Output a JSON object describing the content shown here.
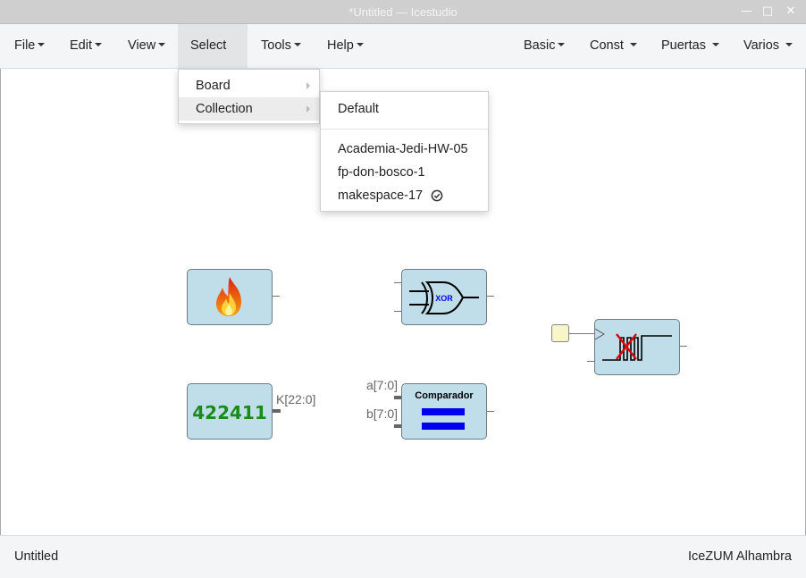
{
  "window": {
    "title": "*Untitled — Icestudio"
  },
  "menubar": {
    "left": [
      {
        "label": "File"
      },
      {
        "label": "Edit"
      },
      {
        "label": "View"
      },
      {
        "label": "Select"
      },
      {
        "label": "Tools"
      },
      {
        "label": "Help"
      }
    ],
    "right": [
      {
        "label": "Basic"
      },
      {
        "label": "Const"
      },
      {
        "label": "Puertas"
      },
      {
        "label": "Varios"
      }
    ]
  },
  "select_menu": {
    "items": [
      {
        "label": "Board"
      },
      {
        "label": "Collection"
      }
    ]
  },
  "collection_submenu": {
    "default_label": "Default",
    "items": [
      {
        "label": "Academia-Jedi-HW-05"
      },
      {
        "label": "fp-don-bosco-1"
      },
      {
        "label": "makespace-17",
        "checked": true
      }
    ]
  },
  "blocks": {
    "constant": {
      "value": "422411",
      "output_label": "K[22:0]",
      "value_color": "#1a8a1a"
    },
    "xor": {
      "label": "XOR"
    },
    "comparator": {
      "title": "Comparador",
      "input_a": "a[7:0]",
      "input_b": "b[7:0]"
    }
  },
  "statusbar": {
    "left": "Untitled",
    "right": "IceZUM Alhambra"
  },
  "colors": {
    "block_fill": "#c0deea",
    "block_border": "#6c7c84",
    "equal_bars": "#0000ee"
  }
}
